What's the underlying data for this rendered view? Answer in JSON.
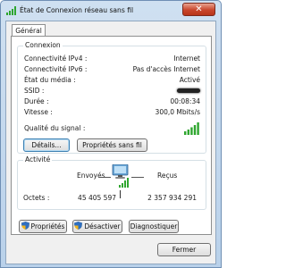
{
  "window": {
    "title": "État de Connexion réseau sans fil",
    "close_glyph": "✕"
  },
  "tabs": [
    {
      "label": "Général"
    }
  ],
  "connexion": {
    "title": "Connexion",
    "rows": [
      {
        "label": "Connectivité IPv4 :",
        "value": "Internet"
      },
      {
        "label": "Connectivité IPv6 :",
        "value": "Pas d'accès Internet"
      },
      {
        "label": "État du média :",
        "value": "Activé"
      },
      {
        "label": "SSID :",
        "value": ""
      },
      {
        "label": "Durée :",
        "value": "00:08:34"
      },
      {
        "label": "Vitesse :",
        "value": "300,0 Mbits/s"
      }
    ],
    "signal_label": "Qualité du signal :",
    "signal_bars": 5,
    "details_button": "Détails...",
    "wireless_props_button": "Propriétés sans fil"
  },
  "activite": {
    "title": "Activité",
    "sent_label": "Envoyés",
    "received_label": "Reçus",
    "bytes_label": "Octets :",
    "bytes_sent": "45 405 597",
    "bytes_received": "2 357 934 291"
  },
  "actions": {
    "properties": "Propriétés",
    "disable": "Désactiver",
    "diagnose": "Diagnostiquer"
  },
  "footer": {
    "close": "Fermer"
  },
  "icons": {
    "title": "wireless-signal-icon",
    "network": "network-computers-icon",
    "shield": "uac-shield-icon"
  },
  "colors": {
    "signal_green": "#2fa62f",
    "accent": "#3c7fb1"
  }
}
